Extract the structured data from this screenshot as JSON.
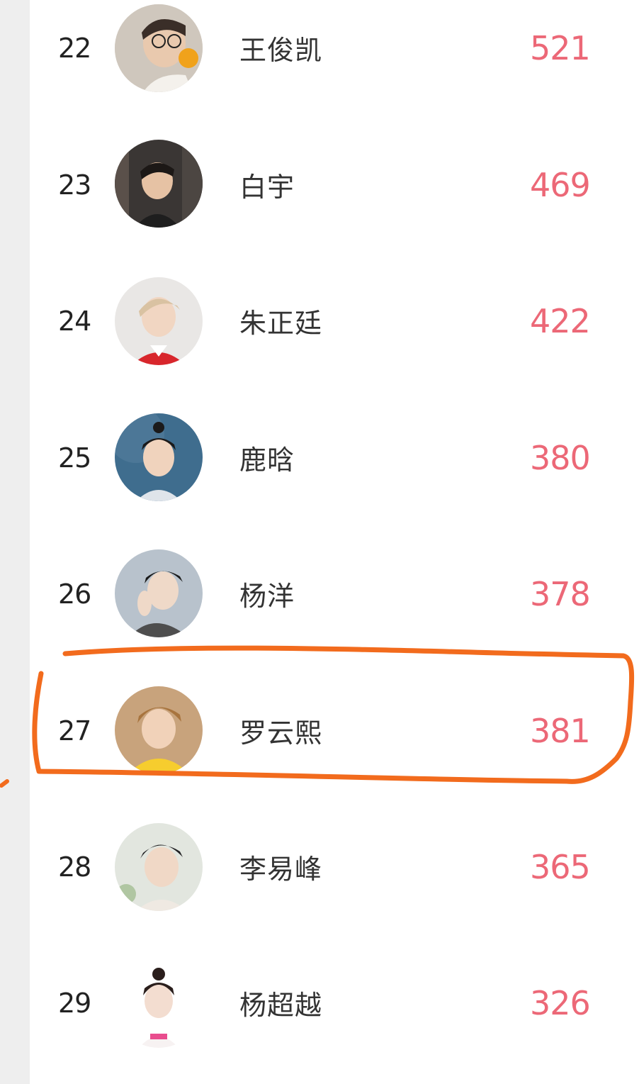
{
  "ranking": {
    "rows": [
      {
        "rank": "22",
        "name": "王俊凯",
        "score": "521"
      },
      {
        "rank": "23",
        "name": "白宇",
        "score": "469"
      },
      {
        "rank": "24",
        "name": "朱正廷",
        "score": "422"
      },
      {
        "rank": "25",
        "name": "鹿晗",
        "score": "380"
      },
      {
        "rank": "26",
        "name": "杨洋",
        "score": "378"
      },
      {
        "rank": "27",
        "name": "罗云熙",
        "score": "381"
      },
      {
        "rank": "28",
        "name": "李易峰",
        "score": "365"
      },
      {
        "rank": "29",
        "name": "杨超越",
        "score": "326"
      }
    ]
  },
  "highlight": {
    "rank": "27",
    "color": "#f26b1d"
  },
  "colors": {
    "score": "#ec6877",
    "rank": "#222222",
    "name": "#333333",
    "background": "#eeeeee",
    "panel": "#ffffff"
  },
  "icons": {
    "avatar": "person-avatar-icon"
  }
}
